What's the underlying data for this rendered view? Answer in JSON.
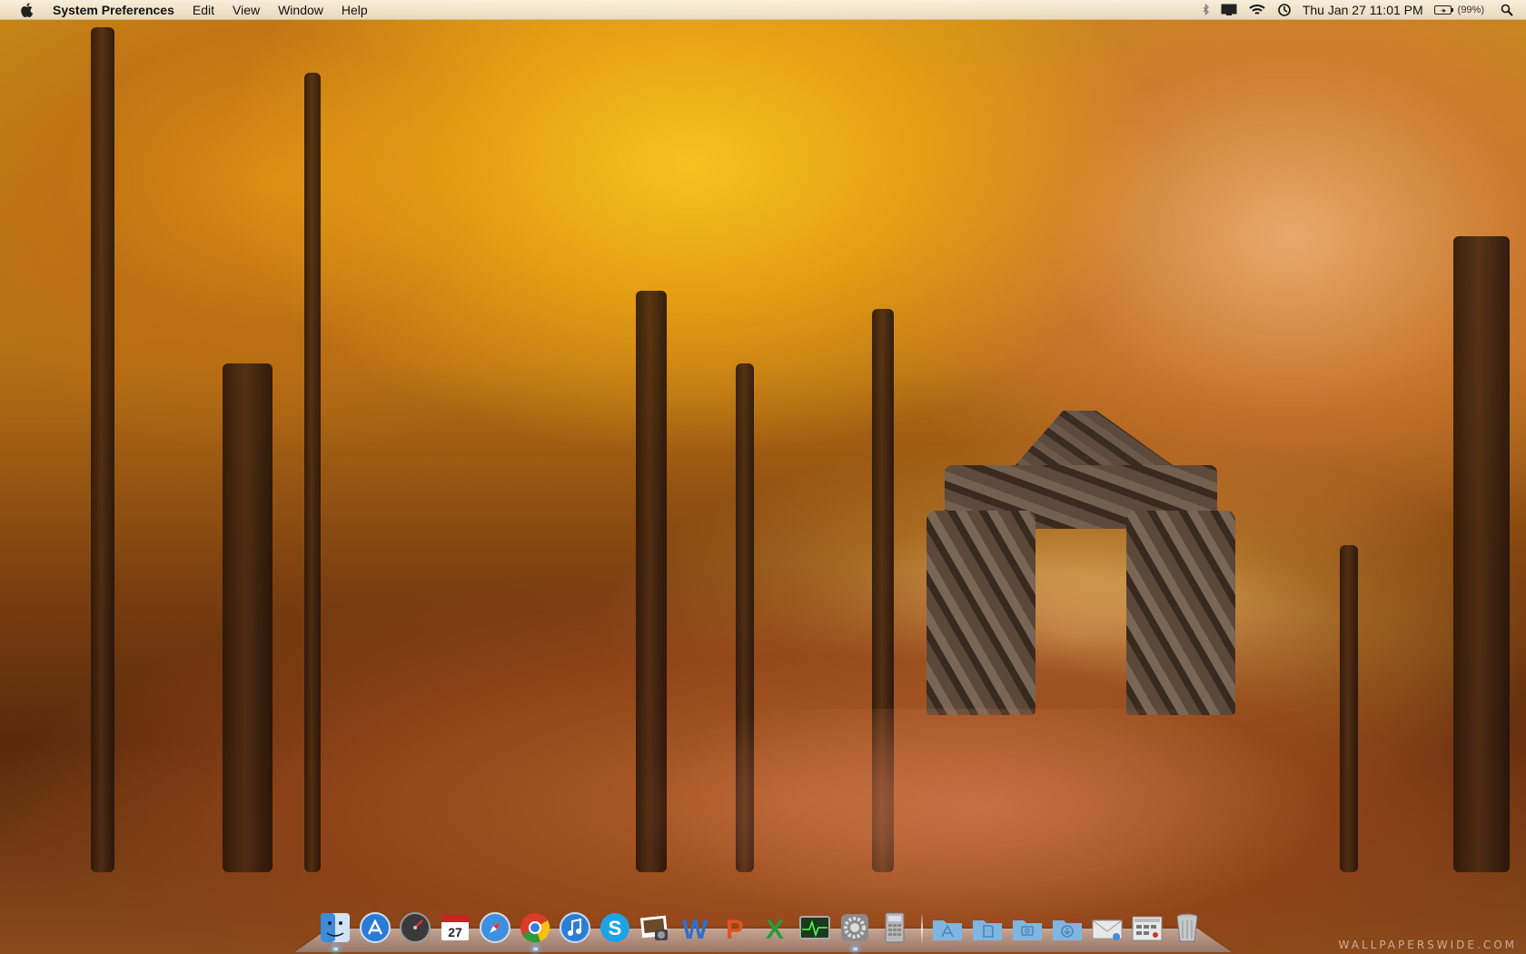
{
  "menubar": {
    "apple_icon": "apple-icon",
    "app_name": "System Preferences",
    "menus": [
      "Edit",
      "View",
      "Window",
      "Help"
    ],
    "status": {
      "bluetooth_icon": "bluetooth-icon",
      "display_icon": "display-icon",
      "wifi_icon": "wifi-icon",
      "time_machine_icon": "time-machine-icon",
      "clock": "Thu Jan 27  11:01 PM",
      "battery_icon": "battery-icon",
      "battery_percent": "(99%)",
      "spotlight_icon": "spotlight-icon"
    }
  },
  "dock": {
    "apps": [
      {
        "icon": "finder-icon",
        "color": "#3f8ad8",
        "running": true
      },
      {
        "icon": "app-store-icon",
        "color": "#2a7ad8",
        "running": false
      },
      {
        "icon": "dashboard-icon",
        "color": "#444444",
        "running": false
      },
      {
        "icon": "ical-icon",
        "color": "#cc2222",
        "label": "27",
        "running": false
      },
      {
        "icon": "safari-icon",
        "color": "#3d8fe0",
        "running": false
      },
      {
        "icon": "chrome-icon",
        "color": "#2f9a3a",
        "running": true
      },
      {
        "icon": "itunes-icon",
        "color": "#2b7ed6",
        "running": false
      },
      {
        "icon": "skype-icon",
        "color": "#1ea3e6",
        "label": "S",
        "running": false
      },
      {
        "icon": "iphoto-icon",
        "color": "#6b4a2a",
        "running": false
      },
      {
        "icon": "word-icon",
        "color": "#2f6fd0",
        "label": "W",
        "running": false
      },
      {
        "icon": "powerpoint-icon",
        "color": "#e0531e",
        "label": "P",
        "running": false
      },
      {
        "icon": "excel-icon",
        "color": "#2c9a3b",
        "label": "X",
        "running": false
      },
      {
        "icon": "activity-monitor-icon",
        "color": "#1b3a1b",
        "running": false
      },
      {
        "icon": "system-preferences-icon",
        "color": "#8a8a8a",
        "running": true
      },
      {
        "icon": "calculator-icon",
        "color": "#b9b9b9",
        "running": false
      }
    ],
    "folders": [
      {
        "icon": "applications-folder-icon",
        "color": "#7fb6e0"
      },
      {
        "icon": "documents-folder-icon",
        "color": "#7fb6e0"
      },
      {
        "icon": "pictures-folder-icon",
        "color": "#7fb6e0"
      },
      {
        "icon": "downloads-folder-icon",
        "color": "#7fb6e0"
      },
      {
        "icon": "mail-stack-icon",
        "color": "#e8e8e8"
      },
      {
        "icon": "screenshots-stack-icon",
        "color": "#e8e8e8"
      },
      {
        "icon": "trash-icon",
        "color": "#c8c8c8"
      }
    ]
  },
  "watermark": "WALLPAPERSWIDE.COM"
}
